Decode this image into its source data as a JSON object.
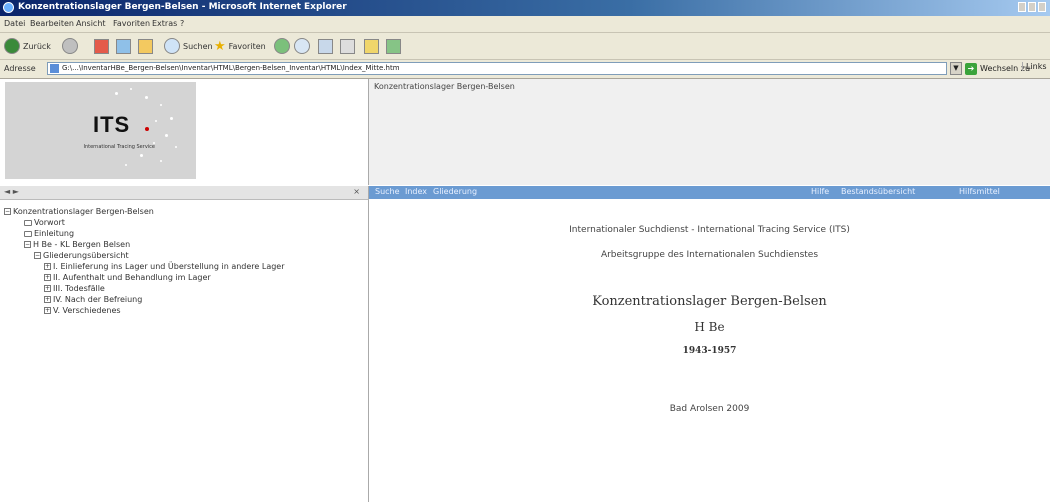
{
  "window": {
    "title": "Konzentrationslager Bergen-Belsen - Microsoft Internet Explorer"
  },
  "menu": [
    "Datei",
    "Bearbeiten",
    "Ansicht",
    "Favoriten",
    "Extras",
    "?"
  ],
  "toolbar": {
    "back_label": "Zurück",
    "search_label": "Suchen",
    "favorites_label": "Favoriten"
  },
  "address": {
    "label": "Adresse",
    "url": "G:\\...\\InventarHBe_Bergen-Belsen\\Inventar\\HTML\\Bergen-Belsen_Inventar\\HTML\\Index_Mitte.htm",
    "go_label": "Wechseln zu",
    "links_label": "Links"
  },
  "logo": {
    "text": "ITS",
    "subtitle": "International Tracing Service"
  },
  "header": {
    "breadcrumb": "Konzentrationslager Bergen-Belsen"
  },
  "left_bar": {
    "nav": "◄ ►",
    "close": "×"
  },
  "right_bar": {
    "left_items": [
      "Suche",
      "Index",
      "Gliederung"
    ],
    "right_items": [
      "Hilfe",
      "Bestandsübersicht",
      "Hilfsmittel"
    ]
  },
  "tree": {
    "root": "Konzentrationslager Bergen-Belsen",
    "vorwort": "Vorwort",
    "einleitung": "Einleitung",
    "hbe": "H Be - KL Bergen Belsen",
    "gliederung": "Gliederungsübersicht",
    "items": [
      "I. Einlieferung ins Lager und Überstellung in andere Lager",
      "II. Aufenthalt und Behandlung im Lager",
      "III. Todesfälle",
      "IV. Nach der Befreiung",
      "V. Verschiedenes"
    ]
  },
  "content": {
    "org": "Internationaler Suchdienst - International Tracing Service (ITS)",
    "department": "Arbeitsgruppe des Internationalen Suchdienstes",
    "title": "Konzentrationslager Bergen-Belsen",
    "code": "H Be",
    "years": "1943-1957",
    "place_date": "Bad Arolsen 2009"
  }
}
